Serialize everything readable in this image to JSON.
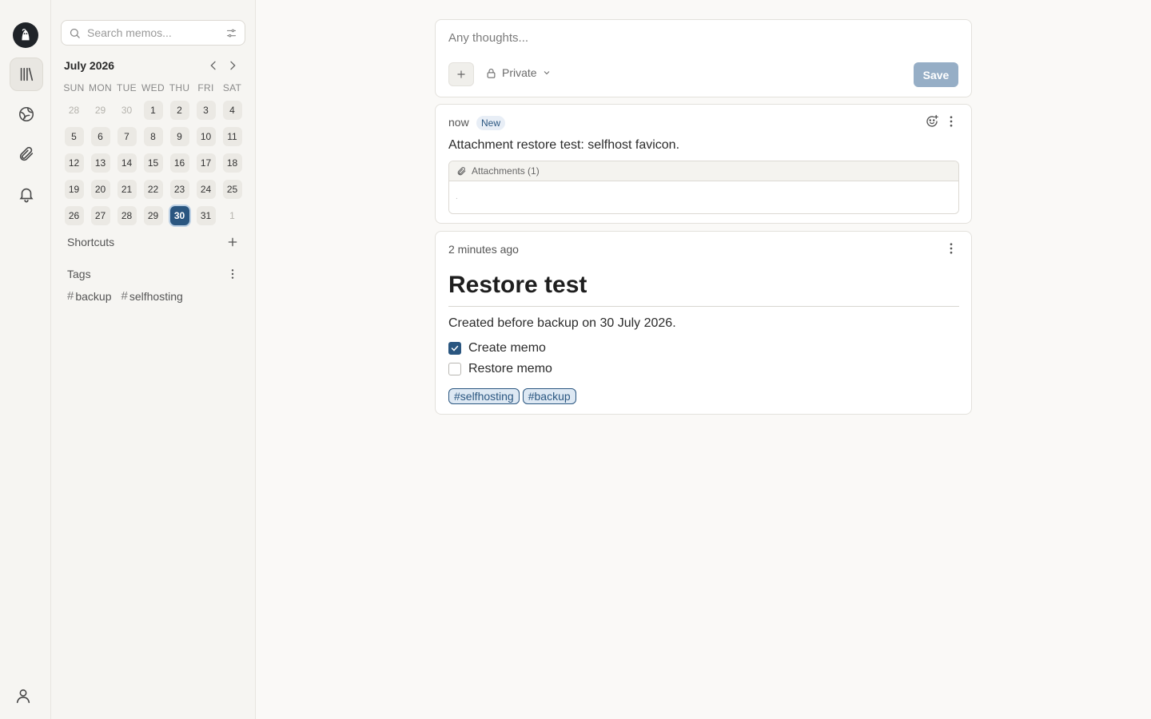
{
  "search": {
    "placeholder": "Search memos..."
  },
  "calendar": {
    "title": "July 2026",
    "weekdays": [
      "SUN",
      "MON",
      "TUE",
      "WED",
      "THU",
      "FRI",
      "SAT"
    ],
    "days": [
      {
        "d": "28",
        "m": true
      },
      {
        "d": "29",
        "m": true
      },
      {
        "d": "30",
        "m": true
      },
      {
        "d": "1"
      },
      {
        "d": "2"
      },
      {
        "d": "3"
      },
      {
        "d": "4"
      },
      {
        "d": "5"
      },
      {
        "d": "6"
      },
      {
        "d": "7"
      },
      {
        "d": "8"
      },
      {
        "d": "9"
      },
      {
        "d": "10"
      },
      {
        "d": "11"
      },
      {
        "d": "12"
      },
      {
        "d": "13"
      },
      {
        "d": "14"
      },
      {
        "d": "15"
      },
      {
        "d": "16"
      },
      {
        "d": "17"
      },
      {
        "d": "18"
      },
      {
        "d": "19"
      },
      {
        "d": "20"
      },
      {
        "d": "21"
      },
      {
        "d": "22"
      },
      {
        "d": "23"
      },
      {
        "d": "24"
      },
      {
        "d": "25"
      },
      {
        "d": "26"
      },
      {
        "d": "27"
      },
      {
        "d": "28"
      },
      {
        "d": "29"
      },
      {
        "d": "30",
        "today": true
      },
      {
        "d": "31"
      },
      {
        "d": "1",
        "m": true
      }
    ]
  },
  "shortcuts": {
    "title": "Shortcuts"
  },
  "tags": {
    "title": "Tags",
    "items": [
      "backup",
      "selfhosting"
    ]
  },
  "editor": {
    "placeholder": "Any thoughts...",
    "visibility": "Private",
    "save_label": "Save"
  },
  "memos": [
    {
      "time": "now",
      "badge": "New",
      "content": "Attachment restore test: selfhost favicon.",
      "attachments_label": "Attachments (1)",
      "attachment_placeholder": "."
    },
    {
      "time": "2 minutes ago",
      "heading": "Restore test",
      "content": "Created before backup on 30 July 2026.",
      "tasks": [
        {
          "label": "Create memo",
          "done": true
        },
        {
          "label": "Restore memo",
          "done": false
        }
      ],
      "tags": [
        "#selfhosting",
        "#backup"
      ]
    }
  ],
  "colors": {
    "accent": "#2a5680",
    "save_disabled": "#96aec6"
  }
}
